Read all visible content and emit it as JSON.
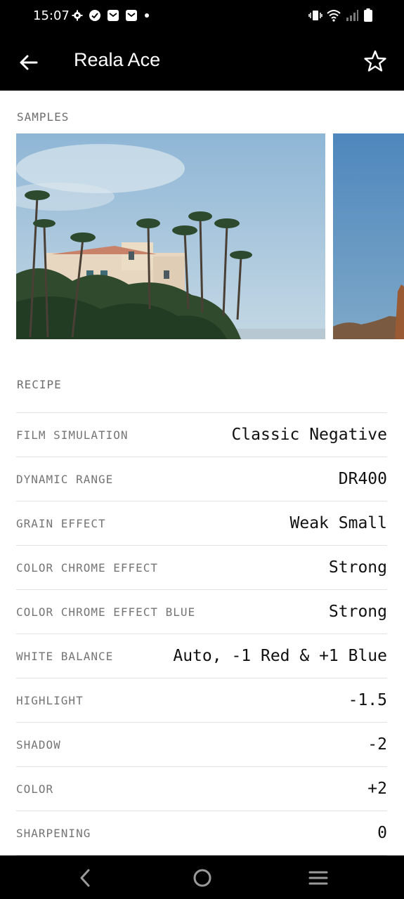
{
  "status_bar": {
    "time": "15:07",
    "left_icons": [
      "gear-icon",
      "check-circle-icon",
      "mail-icon",
      "mail-icon",
      "dot-icon"
    ],
    "right_icons": [
      "vibrate-icon",
      "wifi-icon",
      "signal-icon",
      "battery-icon"
    ]
  },
  "app_bar": {
    "title": "Reala Ace",
    "back_icon": "arrow-left-icon",
    "favorite_icon": "star-outline-icon"
  },
  "samples": {
    "label": "SAMPLES"
  },
  "recipe": {
    "label": "RECIPE",
    "rows": [
      {
        "label": "FILM SIMULATION",
        "value": "Classic Negative"
      },
      {
        "label": "DYNAMIC RANGE",
        "value": "DR400"
      },
      {
        "label": "GRAIN EFFECT",
        "value": "Weak Small"
      },
      {
        "label": "COLOR CHROME EFFECT",
        "value": "Strong"
      },
      {
        "label": "COLOR CHROME EFFECT BLUE",
        "value": "Strong"
      },
      {
        "label": "WHITE BALANCE",
        "value": "Auto, -1 Red & +1 Blue"
      },
      {
        "label": "HIGHLIGHT",
        "value": "-1.5"
      },
      {
        "label": "SHADOW",
        "value": "-2"
      },
      {
        "label": "COLOR",
        "value": "+2"
      },
      {
        "label": "SHARPENING",
        "value": "0"
      }
    ]
  },
  "nav_bar": {
    "icons": [
      "back-triangle-icon",
      "home-circle-icon",
      "menu-lines-icon"
    ]
  },
  "colors": {
    "bar_background": "#000000",
    "page_background": "#ffffff",
    "label_gray": "#757575",
    "divider": "#e2e2e2"
  }
}
